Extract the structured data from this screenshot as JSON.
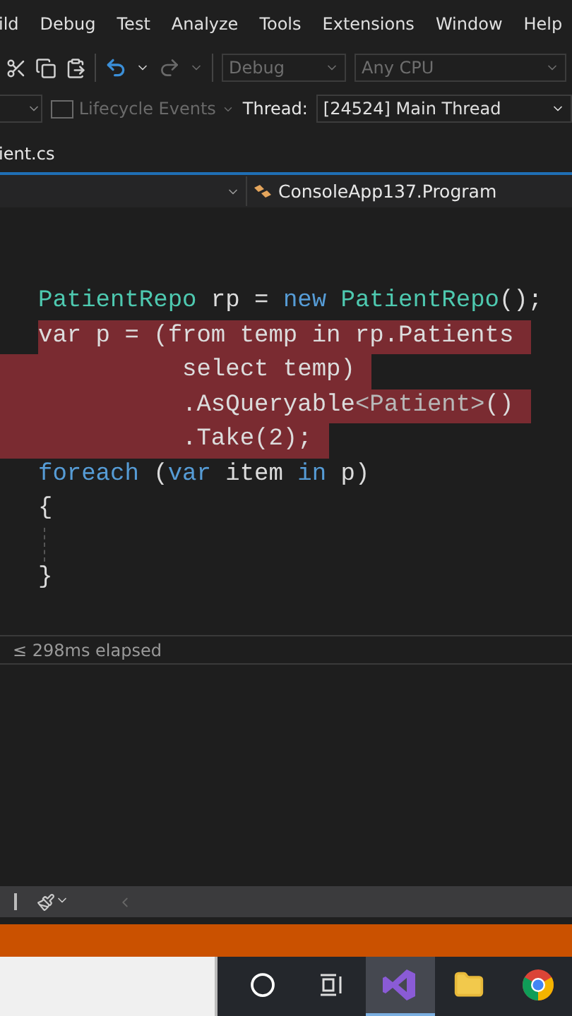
{
  "menu": [
    {
      "label": "ild"
    },
    {
      "label": "Debug"
    },
    {
      "label": "Test"
    },
    {
      "label": "Analyze"
    },
    {
      "label": "Tools"
    },
    {
      "label": "Extensions"
    },
    {
      "label": "Window"
    },
    {
      "label": "Help"
    }
  ],
  "toolbar": {
    "buttons": [
      {
        "kind": "cut",
        "disabled": false
      },
      {
        "kind": "copy",
        "disabled": false
      },
      {
        "kind": "paste",
        "disabled": false
      },
      {
        "kind": "separator"
      },
      {
        "kind": "undo",
        "disabled": false
      },
      {
        "kind": "caret",
        "disabled": false
      },
      {
        "kind": "redo",
        "disabled": true
      },
      {
        "kind": "caret",
        "disabled": true
      },
      {
        "kind": "separator"
      }
    ],
    "combos": [
      {
        "value": "Debug",
        "disabled": true
      },
      {
        "value": "Any CPU",
        "disabled": true
      }
    ]
  },
  "debug_toolbar": {
    "lifecycle": {
      "label": "Lifecycle Events",
      "disabled": true
    },
    "thread_label": "Thread:",
    "thread": "[24524] Main Thread"
  },
  "tab": {
    "label": "ient.cs"
  },
  "nav": {
    "type": "ConsoleApp137.Program"
  },
  "code": [
    {
      "kind": "code",
      "highlighted": false,
      "tokens": [
        {
          "text": "PatientRepo",
          "kind": "type"
        },
        {
          "text": " rp = ",
          "kind": "plain"
        },
        {
          "text": "new",
          "kind": "keyword"
        },
        {
          "text": " PatientRepo",
          "kind": "type"
        },
        {
          "text": "();",
          "kind": "plain"
        }
      ]
    },
    {
      "kind": "code",
      "highlighted": true,
      "tokens": [
        {
          "text": "var p = (from temp in rp.Patients",
          "kind": "plain"
        }
      ]
    },
    {
      "kind": "code",
      "highlighted": true,
      "tokens": [
        {
          "text": "          select temp)",
          "kind": "plain"
        }
      ]
    },
    {
      "kind": "code",
      "highlighted": true,
      "tokens": [
        {
          "text": "          .AsQueryable",
          "kind": "plain"
        },
        {
          "text": "<Patient>",
          "kind": "generic"
        },
        {
          "text": "()",
          "kind": "plain"
        }
      ]
    },
    {
      "kind": "code",
      "highlighted": true,
      "tokens": [
        {
          "text": "          .Take(2);",
          "kind": "plain"
        }
      ]
    },
    {
      "kind": "code",
      "highlighted": false,
      "tokens": [
        {
          "text": "foreach",
          "kind": "keyword"
        },
        {
          "text": " (",
          "kind": "plain"
        },
        {
          "text": "var",
          "kind": "keyword"
        },
        {
          "text": " item ",
          "kind": "plain"
        },
        {
          "text": "in",
          "kind": "keyword"
        },
        {
          "text": " p)",
          "kind": "plain"
        }
      ]
    },
    {
      "kind": "code",
      "highlighted": false,
      "tokens": [
        {
          "text": "{",
          "kind": "plain"
        }
      ]
    },
    {
      "kind": "guide"
    },
    {
      "kind": "code",
      "highlighted": false,
      "tokens": [
        {
          "text": "}",
          "kind": "plain"
        }
      ]
    }
  ],
  "status": "≤ 298ms elapsed",
  "taskbar": {
    "apps": [
      {
        "kind": "circle",
        "selected": false
      },
      {
        "kind": "taskview",
        "selected": false
      },
      {
        "kind": "ide",
        "selected": true
      },
      {
        "kind": "folder",
        "selected": false
      },
      {
        "kind": "browser",
        "selected": false
      }
    ]
  }
}
